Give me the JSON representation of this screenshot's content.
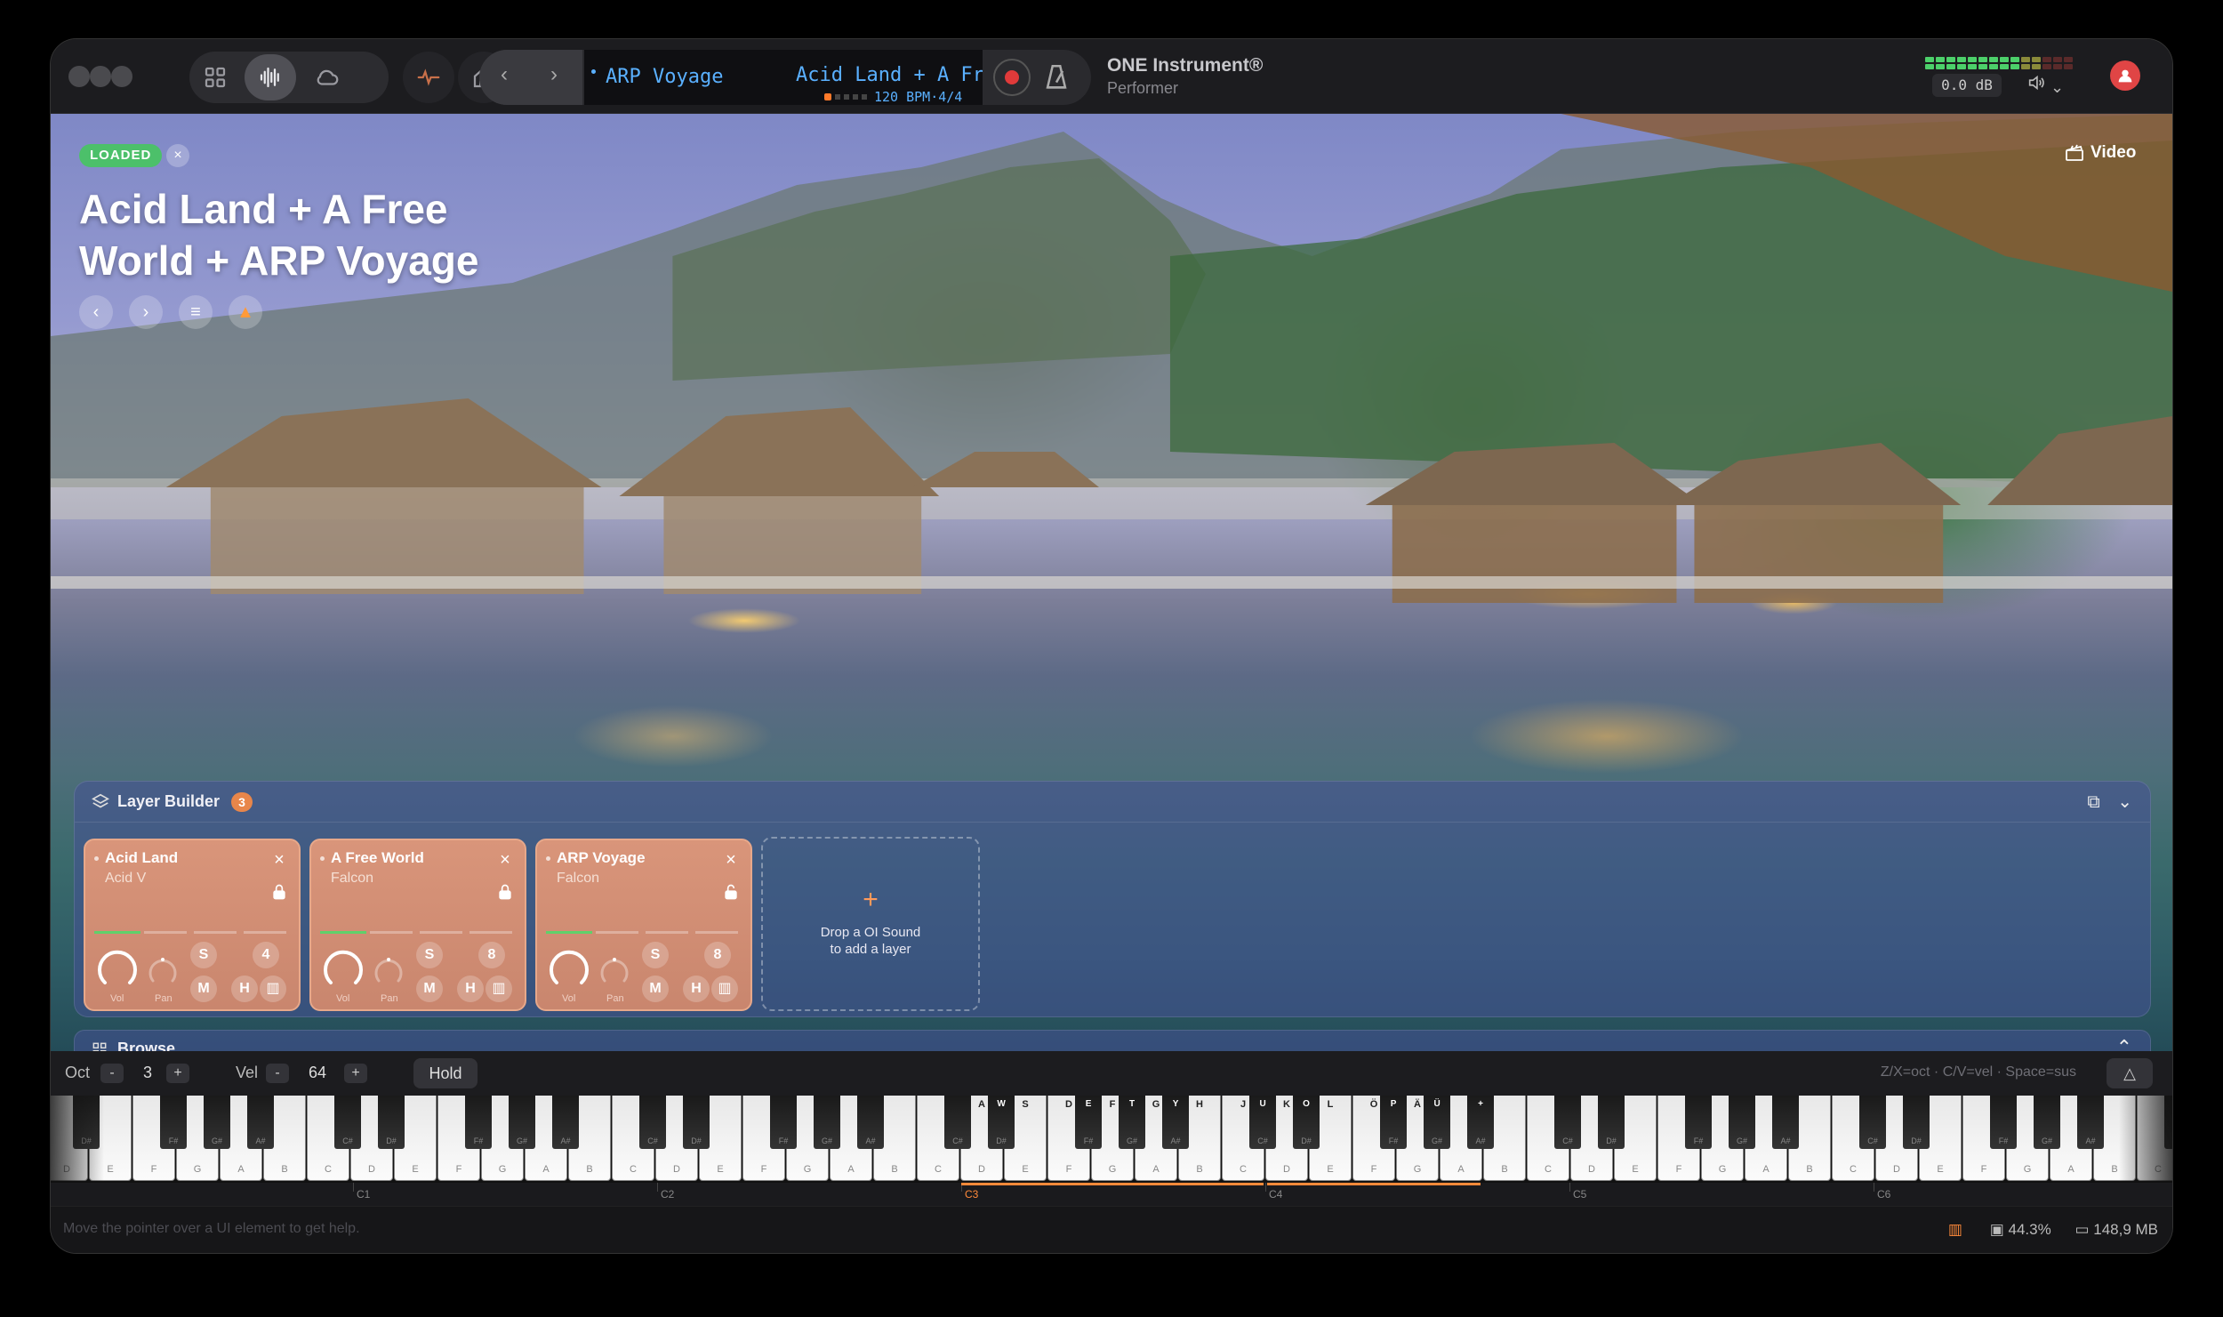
{
  "app": {
    "name": "ONE Instrument®",
    "subtitle": "Performer"
  },
  "transport": {
    "prev": "‹",
    "next": "›",
    "preset_a": "ARP Voyage",
    "preset_b": "Acid Land + A Free World",
    "tempo_info": "120 BPM·4/4"
  },
  "meter": {
    "db": "0.0 dB"
  },
  "hero": {
    "badge": "LOADED",
    "title": "Acid Land + A Free World + ARP Voyage",
    "video_label": "Video"
  },
  "layer_builder": {
    "title": "Layer Builder",
    "count": "3",
    "layers": [
      {
        "name": "Acid Land",
        "engine": "Acid V",
        "locked": true,
        "channel": "4",
        "vol_label": "Vol",
        "pan_label": "Pan",
        "solo": "S",
        "mute": "M",
        "hold": "H"
      },
      {
        "name": "A Free World",
        "engine": "Falcon",
        "locked": true,
        "channel": "8",
        "vol_label": "Vol",
        "pan_label": "Pan",
        "solo": "S",
        "mute": "M",
        "hold": "H"
      },
      {
        "name": "ARP Voyage",
        "engine": "Falcon",
        "locked": false,
        "channel": "8",
        "vol_label": "Vol",
        "pan_label": "Pan",
        "solo": "S",
        "mute": "M",
        "hold": "H"
      }
    ],
    "drop_hint": "Drop a OI Sound\nto add a layer"
  },
  "browse": {
    "title": "Browse"
  },
  "keyboard_bar": {
    "oct_label": "Oct",
    "oct_value": "3",
    "vel_label": "Vel",
    "vel_value": "64",
    "hold_label": "Hold",
    "minus": "-",
    "plus": "+",
    "shortcut_hint": "Z/X=oct · C/V=vel · Space=sus"
  },
  "octaves": [
    "C1",
    "C2",
    "C3",
    "C4",
    "C5",
    "C6"
  ],
  "status": {
    "help": "Move the pointer over a UI element to get help.",
    "cpu": "44.3%",
    "memory": "148,9 MB"
  },
  "colors": {
    "accent": "#ff8a3a",
    "loaded": "#4cc06a",
    "lcd_text": "#5ab0ff",
    "layer_card": "#cf8c72"
  }
}
